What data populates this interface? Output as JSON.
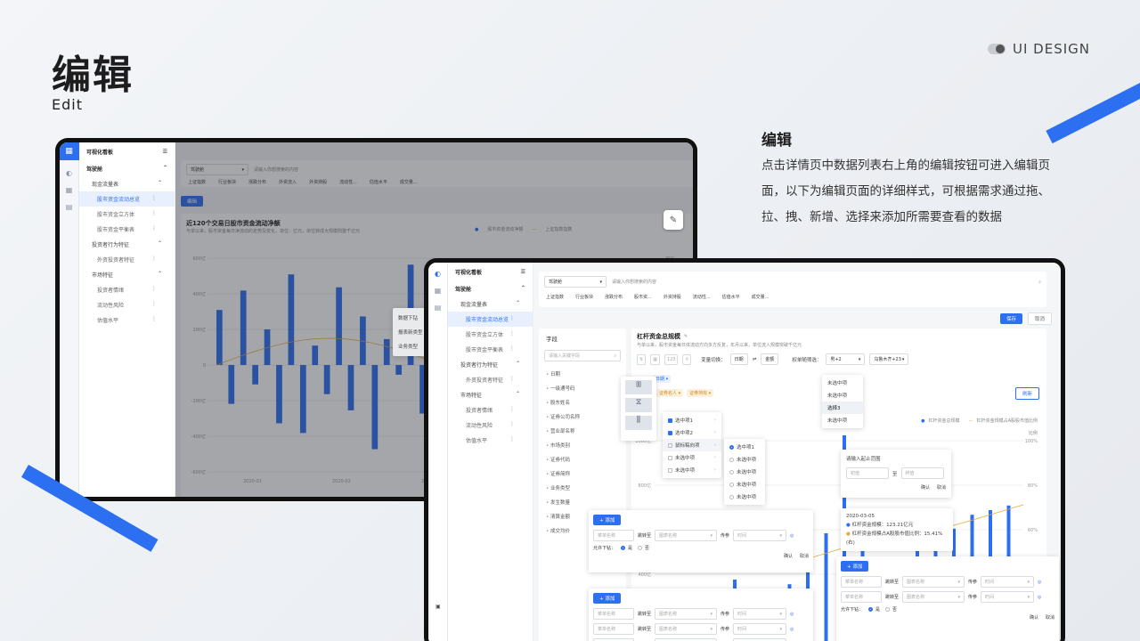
{
  "hero": {
    "title": "编辑",
    "subtitle": "Edit"
  },
  "brand": {
    "label": "UI DESIGN"
  },
  "description": {
    "title": "编辑",
    "body": "点击详情页中数据列表右上角的编辑按钮可进入编辑页面，以下为编辑页面的详细样式，可根据需求通过拖、拉、拽、新增、选择来添加所需要查看的数据"
  },
  "app": {
    "name": "可视化看板",
    "nav_header": "驾驶舱",
    "groups": [
      {
        "label": "现金流量表",
        "items": [
          "股市资金流动总览",
          "股市资金立方体",
          "股市资金平衡表"
        ]
      },
      {
        "label": "投资者行为特征",
        "items": [
          "外资投资者特征"
        ]
      },
      {
        "label": "市场特征",
        "items": [
          "投资者情绪",
          "流动性风险",
          "估值水平"
        ]
      }
    ],
    "active_item": "股市资金流动总览",
    "search_select": "驾驶舱",
    "search_placeholder": "请输入你想搜索的内容",
    "tabs_back": [
      "上证指数",
      "行业板块",
      "涨跌分布",
      "外资流入",
      "外资持股",
      "流动性...",
      "估值水平",
      "成交量..."
    ],
    "tabs_front": [
      "上证指数",
      "行业板块",
      "涨跌分布",
      "股市资...",
      "外资持股",
      "流动性...",
      "估值水平",
      "成交量..."
    ],
    "save": "保存",
    "cancel": "取消",
    "edit_tag": "编辑"
  },
  "back_chart": {
    "title": "近120个交易日股市资金流动净额",
    "subtitle": "与单以来，股市资金每日净流动的走势及变化，单位：亿元，单位转成大规模则整千亿元",
    "legend": [
      "股市资金流动净额",
      "上证指数指数"
    ],
    "menu": [
      "数据下钻",
      "报表新类型",
      "业务类型"
    ],
    "x_ticks": [
      "2020-01",
      "2020-02",
      "2020-03"
    ],
    "y_ticks": [
      "600亿",
      "400亿",
      "200亿",
      "0",
      "-200亿",
      "-400亿",
      "-600亿"
    ],
    "right_tick": "35%"
  },
  "front": {
    "field_title": "字段",
    "field_search": "请输入关键字段",
    "fields": [
      "日期",
      "一级通号码",
      "股东姓名",
      "证券公司名称",
      "营业部名称",
      "市场类别",
      "证券代码",
      "证券简称",
      "业务类型",
      "发生数量",
      "清算金额",
      "成交均价"
    ],
    "chart_title": "杠杆资金总规模",
    "chart_sub": "与单以来，股市资金每日体流动方向多方反复，年月以来，单位流入规模突破千亿元",
    "var_switch": "变量切换：",
    "var_a": "日期",
    "var_b": "金额",
    "filter_label": "权单随筛选：",
    "filter_a": "男+2",
    "filter_b": "乌鲁木齐+23",
    "filter_options": [
      "未选中项",
      "未选中项",
      "选择3",
      "未选中项"
    ],
    "refresh": "刷新",
    "date_tag": "日期",
    "tag_a": "证券名人",
    "tag_b": "证券持有",
    "check_items": [
      {
        "label": "选中项1",
        "on": true
      },
      {
        "label": "选中项2",
        "on": true
      },
      {
        "label": "鼠标稿向项",
        "on": false
      },
      {
        "label": "未选中项",
        "on": false
      },
      {
        "label": "未选中项",
        "on": false
      }
    ],
    "radio_items": [
      {
        "label": "选中项1",
        "on": true
      },
      {
        "label": "未选中项",
        "on": false
      },
      {
        "label": "未选中项",
        "on": false
      },
      {
        "label": "未选中项",
        "on": false
      },
      {
        "label": "未选中项",
        "on": false
      }
    ],
    "legend": [
      "杠杆资金总规模",
      "杠杆资金规模占A股股市值比例"
    ],
    "unit_label": "金额",
    "ratio_label": "比例",
    "y_ticks": [
      "1000亿",
      "800亿",
      "600亿",
      "400亿"
    ],
    "y2_ticks": [
      "100%",
      "80%",
      "60%",
      "40%"
    ],
    "range_title": "请输入起止范围",
    "range_from": "初值",
    "range_to": "终值",
    "range_sep": "至",
    "confirm": "确认",
    "cancel": "取消",
    "tip_date": "2020-03-05",
    "tip_a": "杠杆资金规模：123.21亿元",
    "tip_b": "杠杆资金规模占A股股市值比例：15.41%(右)",
    "add": "+ 添加",
    "menu_name": "菜单名称",
    "jump": "跳转至",
    "chart_name": "图表名称",
    "pass": "传参",
    "time": "时间",
    "allow_drill": "允许下钻：",
    "yes": "是",
    "no": "否"
  }
}
